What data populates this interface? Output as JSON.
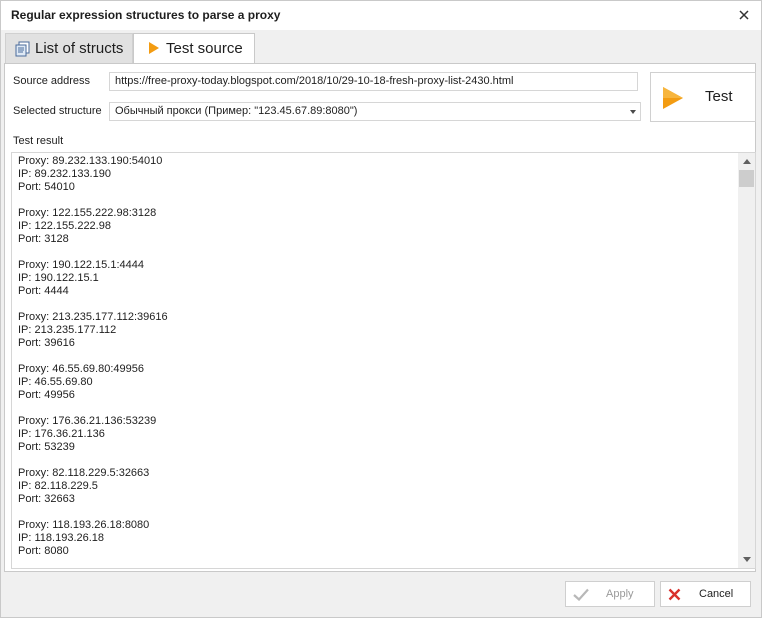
{
  "window": {
    "title": "Regular expression structures to parse a proxy"
  },
  "tabs": [
    {
      "label": "List of structs",
      "icon": "struct-list-icon",
      "active": false
    },
    {
      "label": "Test source",
      "icon": "play-icon",
      "active": true
    }
  ],
  "form": {
    "source_address_label": "Source address",
    "source_address_value": "https://free-proxy-today.blogspot.com/2018/10/29-10-18-fresh-proxy-list-2430.html",
    "selected_structure_label": "Selected structure",
    "selected_structure_value": "Обычный прокси (Пример: \"123.45.67.89:8080\")",
    "test_button_label": "Test",
    "test_result_label": "Test result"
  },
  "test_result": {
    "text": "Proxy: 89.232.133.190:54010\nIP: 89.232.133.190\nPort: 54010\n\nProxy: 122.155.222.98:3128\nIP: 122.155.222.98\nPort: 3128\n\nProxy: 190.122.15.1:4444\nIP: 190.122.15.1\nPort: 4444\n\nProxy: 213.235.177.112:39616\nIP: 213.235.177.112\nPort: 39616\n\nProxy: 46.55.69.80:49956\nIP: 46.55.69.80\nPort: 49956\n\nProxy: 176.36.21.136:53239\nIP: 176.36.21.136\nPort: 53239\n\nProxy: 82.118.229.5:32663\nIP: 82.118.229.5\nPort: 32663\n\nProxy: 118.193.26.18:8080\nIP: 118.193.26.18\nPort: 8080"
  },
  "footer": {
    "apply_label": "Apply",
    "cancel_label": "Cancel"
  },
  "colors": {
    "accent_orange": "#f39c12",
    "cancel_red": "#d9302c",
    "apply_check_disabled": "#b8b8b8"
  }
}
